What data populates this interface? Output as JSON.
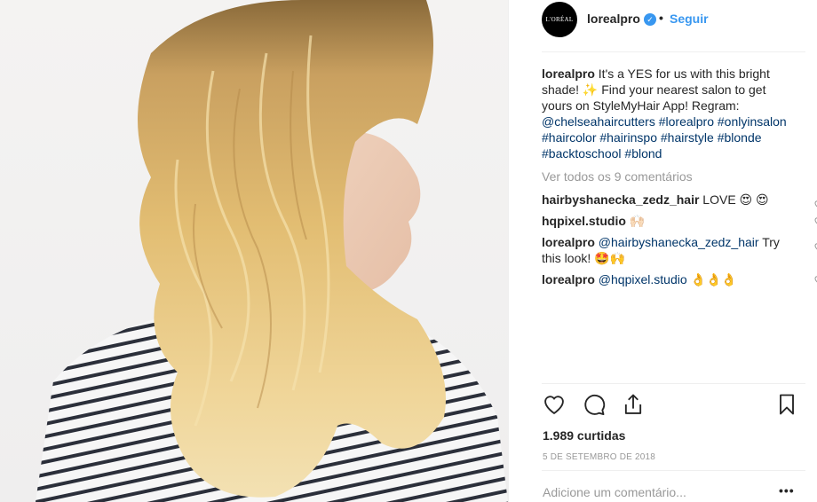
{
  "header": {
    "avatar_text": "L'ORÉAL",
    "username": "lorealpro",
    "verified_mark": "✓",
    "separator": "•",
    "follow_label": "Seguir"
  },
  "caption": {
    "user": "lorealpro",
    "text": " It's a YES for us with this bright shade! ✨ Find your nearest salon to get yours on StyleMyHair App! Regram: ",
    "mention": "@chelseahaircutters",
    "hashtags": [
      "#lorealpro",
      "#onlyinsalon",
      "#haircolor",
      "#hairinspo",
      "#hairstyle",
      "#blonde",
      "#backtoschool",
      "#blond"
    ]
  },
  "view_all_comments": "Ver todos os 9 comentários",
  "comments": [
    {
      "user": "hairbyshanecka_zedz_hair",
      "mention": "",
      "text": " LOVE 😍 😍"
    },
    {
      "user": "hqpixel.studio",
      "mention": "",
      "text": " 🙌🏻"
    },
    {
      "user": "lorealpro",
      "mention": "@hairbyshanecka_zedz_hair",
      "text": " Try this look! 🤩🙌"
    },
    {
      "user": "lorealpro",
      "mention": "@hqpixel.studio",
      "text": " 👌👌👌"
    }
  ],
  "likes": "1.989 curtidas",
  "date": "5 DE SETEMBRO DE 2018",
  "add_comment_placeholder": "Adicione um comentário...",
  "more_label": "•••",
  "icons": [
    "heart-icon",
    "comment-icon",
    "share-icon",
    "bookmark-icon",
    "verified-badge-icon"
  ],
  "colors": {
    "link": "#3897f0",
    "hashtag": "#003569",
    "muted": "#999999",
    "text": "#262626"
  }
}
